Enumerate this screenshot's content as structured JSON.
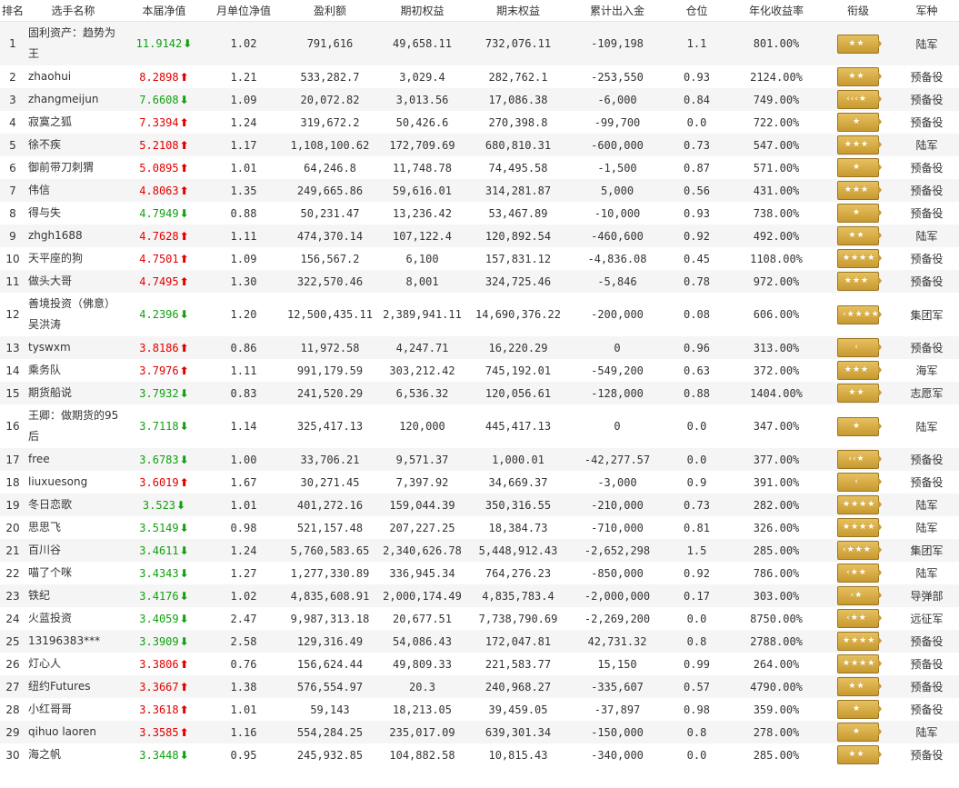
{
  "headers": [
    "排名",
    "选手名称",
    "本届净值",
    "月单位净值",
    "盈利额",
    "期初权益",
    "期末权益",
    "累计出入金",
    "仓位",
    "年化收益率",
    "衔级",
    "军种"
  ],
  "rows": [
    {
      "rank": "1",
      "name": "固利资产：趋势为王",
      "nv": "11.9142",
      "dir": "down",
      "monthly": "1.02",
      "profit": "791,616",
      "start": "49,658.11",
      "end": "732,076.11",
      "flow": "-109,198",
      "pos": "1.1",
      "annual": "801.00%",
      "badge": "**",
      "branch": "陆军",
      "tall": true
    },
    {
      "rank": "2",
      "name": "zhaohui",
      "nv": "8.2898",
      "dir": "up",
      "monthly": "1.21",
      "profit": "533,282.7",
      "start": "3,029.4",
      "end": "282,762.1",
      "flow": "-253,550",
      "pos": "0.93",
      "annual": "2124.00%",
      "badge": "**",
      "branch": "预备役",
      "tall": false
    },
    {
      "rank": "3",
      "name": "zhangmeijun",
      "nv": "7.6608",
      "dir": "down",
      "monthly": "1.09",
      "profit": "20,072.82",
      "start": "3,013.56",
      "end": "17,086.38",
      "flow": "-6,000",
      "pos": "0.84",
      "annual": "749.00%",
      "badge": "<<<*",
      "branch": "预备役",
      "tall": false
    },
    {
      "rank": "4",
      "name": "寂寞之狐",
      "nv": "7.3394",
      "dir": "up",
      "monthly": "1.24",
      "profit": "319,672.2",
      "start": "50,426.6",
      "end": "270,398.8",
      "flow": "-99,700",
      "pos": "0.0",
      "annual": "722.00%",
      "badge": "*",
      "branch": "预备役",
      "tall": false
    },
    {
      "rank": "5",
      "name": "徐不疾",
      "nv": "5.2108",
      "dir": "up",
      "monthly": "1.17",
      "profit": "1,108,100.62",
      "start": "172,709.69",
      "end": "680,810.31",
      "flow": "-600,000",
      "pos": "0.73",
      "annual": "547.00%",
      "badge": "***",
      "branch": "陆军",
      "tall": false
    },
    {
      "rank": "6",
      "name": "御前带刀刺猬",
      "nv": "5.0895",
      "dir": "up",
      "monthly": "1.01",
      "profit": "64,246.8",
      "start": "11,748.78",
      "end": "74,495.58",
      "flow": "-1,500",
      "pos": "0.87",
      "annual": "571.00%",
      "badge": "*",
      "branch": "预备役",
      "tall": false
    },
    {
      "rank": "7",
      "name": "伟信",
      "nv": "4.8063",
      "dir": "up",
      "monthly": "1.35",
      "profit": "249,665.86",
      "start": "59,616.01",
      "end": "314,281.87",
      "flow": "5,000",
      "pos": "0.56",
      "annual": "431.00%",
      "badge": "***",
      "branch": "预备役",
      "tall": false
    },
    {
      "rank": "8",
      "name": "得与失",
      "nv": "4.7949",
      "dir": "down",
      "monthly": "0.88",
      "profit": "50,231.47",
      "start": "13,236.42",
      "end": "53,467.89",
      "flow": "-10,000",
      "pos": "0.93",
      "annual": "738.00%",
      "badge": "*",
      "branch": "预备役",
      "tall": false
    },
    {
      "rank": "9",
      "name": "zhgh1688",
      "nv": "4.7628",
      "dir": "up",
      "monthly": "1.11",
      "profit": "474,370.14",
      "start": "107,122.4",
      "end": "120,892.54",
      "flow": "-460,600",
      "pos": "0.92",
      "annual": "492.00%",
      "badge": "**",
      "branch": "陆军",
      "tall": false
    },
    {
      "rank": "10",
      "name": "天平座的狗",
      "nv": "4.7501",
      "dir": "up",
      "monthly": "1.09",
      "profit": "156,567.2",
      "start": "6,100",
      "end": "157,831.12",
      "flow": "-4,836.08",
      "pos": "0.45",
      "annual": "1108.00%",
      "badge": "****",
      "branch": "预备役",
      "tall": false
    },
    {
      "rank": "11",
      "name": "做头大哥",
      "nv": "4.7495",
      "dir": "up",
      "monthly": "1.30",
      "profit": "322,570.46",
      "start": "8,001",
      "end": "324,725.46",
      "flow": "-5,846",
      "pos": "0.78",
      "annual": "972.00%",
      "badge": "***",
      "branch": "预备役",
      "tall": false
    },
    {
      "rank": "12",
      "name": "善境投资（佛意）吴洪涛",
      "nv": "4.2396",
      "dir": "down",
      "monthly": "1.20",
      "profit": "12,500,435.11",
      "start": "2,389,941.11",
      "end": "14,690,376.22",
      "flow": "-200,000",
      "pos": "0.08",
      "annual": "606.00%",
      "badge": "<****",
      "branch": "集团军",
      "tall": true
    },
    {
      "rank": "13",
      "name": "tyswxm",
      "nv": "3.8186",
      "dir": "up",
      "monthly": "0.86",
      "profit": "11,972.58",
      "start": "4,247.71",
      "end": "16,220.29",
      "flow": "0",
      "pos": "0.96",
      "annual": "313.00%",
      "badge": "<",
      "branch": "预备役",
      "tall": false
    },
    {
      "rank": "14",
      "name": "乘务队",
      "nv": "3.7976",
      "dir": "up",
      "monthly": "1.11",
      "profit": "991,179.59",
      "start": "303,212.42",
      "end": "745,192.01",
      "flow": "-549,200",
      "pos": "0.63",
      "annual": "372.00%",
      "badge": "***",
      "branch": "海军",
      "tall": false
    },
    {
      "rank": "15",
      "name": "期货船说",
      "nv": "3.7932",
      "dir": "down",
      "monthly": "0.83",
      "profit": "241,520.29",
      "start": "6,536.32",
      "end": "120,056.61",
      "flow": "-128,000",
      "pos": "0.88",
      "annual": "1404.00%",
      "badge": "**",
      "branch": "志愿军",
      "tall": false
    },
    {
      "rank": "16",
      "name": "王卿：做期货的95后",
      "nv": "3.7118",
      "dir": "down",
      "monthly": "1.14",
      "profit": "325,417.13",
      "start": "120,000",
      "end": "445,417.13",
      "flow": "0",
      "pos": "0.0",
      "annual": "347.00%",
      "badge": "*",
      "branch": "陆军",
      "tall": true
    },
    {
      "rank": "17",
      "name": "free",
      "nv": "3.6783",
      "dir": "down",
      "monthly": "1.00",
      "profit": "33,706.21",
      "start": "9,571.37",
      "end": "1,000.01",
      "flow": "-42,277.57",
      "pos": "0.0",
      "annual": "377.00%",
      "badge": "<<*",
      "branch": "预备役",
      "tall": false
    },
    {
      "rank": "18",
      "name": "liuxuesong",
      "nv": "3.6019",
      "dir": "up",
      "monthly": "1.67",
      "profit": "30,271.45",
      "start": "7,397.92",
      "end": "34,669.37",
      "flow": "-3,000",
      "pos": "0.9",
      "annual": "391.00%",
      "badge": "<",
      "branch": "预备役",
      "tall": false
    },
    {
      "rank": "19",
      "name": "冬日恋歌",
      "nv": "3.523",
      "dir": "down",
      "monthly": "1.01",
      "profit": "401,272.16",
      "start": "159,044.39",
      "end": "350,316.55",
      "flow": "-210,000",
      "pos": "0.73",
      "annual": "282.00%",
      "badge": "****",
      "branch": "陆军",
      "tall": false
    },
    {
      "rank": "20",
      "name": "思思飞",
      "nv": "3.5149",
      "dir": "down",
      "monthly": "0.98",
      "profit": "521,157.48",
      "start": "207,227.25",
      "end": "18,384.73",
      "flow": "-710,000",
      "pos": "0.81",
      "annual": "326.00%",
      "badge": "****",
      "branch": "陆军",
      "tall": false
    },
    {
      "rank": "21",
      "name": "百川谷",
      "nv": "3.4611",
      "dir": "down",
      "monthly": "1.24",
      "profit": "5,760,583.65",
      "start": "2,340,626.78",
      "end": "5,448,912.43",
      "flow": "-2,652,298",
      "pos": "1.5",
      "annual": "285.00%",
      "badge": "<***",
      "branch": "集团军",
      "tall": false
    },
    {
      "rank": "22",
      "name": "喵了个咪",
      "nv": "3.4343",
      "dir": "down",
      "monthly": "1.27",
      "profit": "1,277,330.89",
      "start": "336,945.34",
      "end": "764,276.23",
      "flow": "-850,000",
      "pos": "0.92",
      "annual": "786.00%",
      "badge": "<**",
      "branch": "陆军",
      "tall": false
    },
    {
      "rank": "23",
      "name": "铁纪",
      "nv": "3.4176",
      "dir": "down",
      "monthly": "1.02",
      "profit": "4,835,608.91",
      "start": "2,000,174.49",
      "end": "4,835,783.4",
      "flow": "-2,000,000",
      "pos": "0.17",
      "annual": "303.00%",
      "badge": "<*",
      "branch": "导弹部",
      "tall": false
    },
    {
      "rank": "24",
      "name": "火蓝投资",
      "nv": "3.4059",
      "dir": "down",
      "monthly": "2.47",
      "profit": "9,987,313.18",
      "start": "20,677.51",
      "end": "7,738,790.69",
      "flow": "-2,269,200",
      "pos": "0.0",
      "annual": "8750.00%",
      "badge": "<**",
      "branch": "远征军",
      "tall": false
    },
    {
      "rank": "25",
      "name": "13196383***",
      "nv": "3.3909",
      "dir": "down",
      "monthly": "2.58",
      "profit": "129,316.49",
      "start": "54,086.43",
      "end": "172,047.81",
      "flow": "42,731.32",
      "pos": "0.8",
      "annual": "2788.00%",
      "badge": "****",
      "branch": "预备役",
      "tall": false
    },
    {
      "rank": "26",
      "name": "灯心人",
      "nv": "3.3806",
      "dir": "up",
      "monthly": "0.76",
      "profit": "156,624.44",
      "start": "49,809.33",
      "end": "221,583.77",
      "flow": "15,150",
      "pos": "0.99",
      "annual": "264.00%",
      "badge": "****",
      "branch": "预备役",
      "tall": false
    },
    {
      "rank": "27",
      "name": "纽约Futures",
      "nv": "3.3667",
      "dir": "up",
      "monthly": "1.38",
      "profit": "576,554.97",
      "start": "20.3",
      "end": "240,968.27",
      "flow": "-335,607",
      "pos": "0.57",
      "annual": "4790.00%",
      "badge": "**",
      "branch": "预备役",
      "tall": false
    },
    {
      "rank": "28",
      "name": "小红哥哥",
      "nv": "3.3618",
      "dir": "up",
      "monthly": "1.01",
      "profit": "59,143",
      "start": "18,213.05",
      "end": "39,459.05",
      "flow": "-37,897",
      "pos": "0.98",
      "annual": "359.00%",
      "badge": "*",
      "branch": "预备役",
      "tall": false
    },
    {
      "rank": "29",
      "name": "qihuo laoren",
      "nv": "3.3585",
      "dir": "up",
      "monthly": "1.16",
      "profit": "554,284.25",
      "start": "235,017.09",
      "end": "639,301.34",
      "flow": "-150,000",
      "pos": "0.8",
      "annual": "278.00%",
      "badge": "*",
      "branch": "陆军",
      "tall": false
    },
    {
      "rank": "30",
      "name": "海之帆",
      "nv": "3.3448",
      "dir": "down",
      "monthly": "0.95",
      "profit": "245,932.85",
      "start": "104,882.58",
      "end": "10,815.43",
      "flow": "-340,000",
      "pos": "0.0",
      "annual": "285.00%",
      "badge": "**",
      "branch": "预备役",
      "tall": false
    }
  ],
  "colors": {
    "up": "#e00000",
    "down": "#12a012",
    "badge": "#c89a30"
  }
}
